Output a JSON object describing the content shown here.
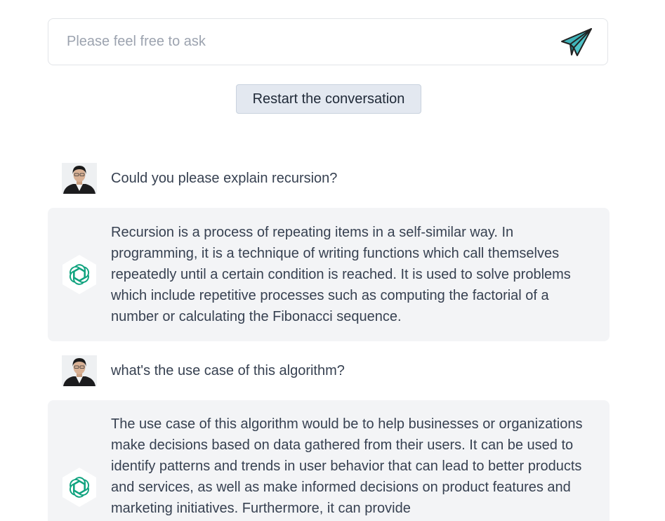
{
  "input": {
    "placeholder": "Please feel free to ask",
    "value": ""
  },
  "send": {
    "icon": "paper-plane-icon",
    "color": "#4fc3c8"
  },
  "restart": {
    "label": "Restart the conversation"
  },
  "messages": [
    {
      "role": "user",
      "avatar": "user-avatar",
      "text": "Could you please explain recursion?"
    },
    {
      "role": "assistant",
      "avatar": "openai-logo-icon",
      "text": "Recursion is a process of repeating items in a self-similar way. In programming, it is a technique of writing functions which call themselves repeatedly until a certain condition is reached. It is used to solve problems which include repetitive processes such as computing the factorial of a number or calculating the Fibonacci sequence."
    },
    {
      "role": "user",
      "avatar": "user-avatar",
      "text": "what's the use case of this algorithm?"
    },
    {
      "role": "assistant",
      "avatar": "openai-logo-icon",
      "text": "The use case of this algorithm would be to help businesses or organizations make decisions based on data gathered from their users. It can be used to identify patterns and trends in user behavior that can lead to better products and services, as well as make informed decisions on product features and marketing initiatives. Furthermore, it can provide"
    }
  ],
  "colors": {
    "assistant_bg": "#f3f4f6",
    "button_bg": "#e3e8f0",
    "logo_green": "#10a37f",
    "text": "#374151"
  }
}
